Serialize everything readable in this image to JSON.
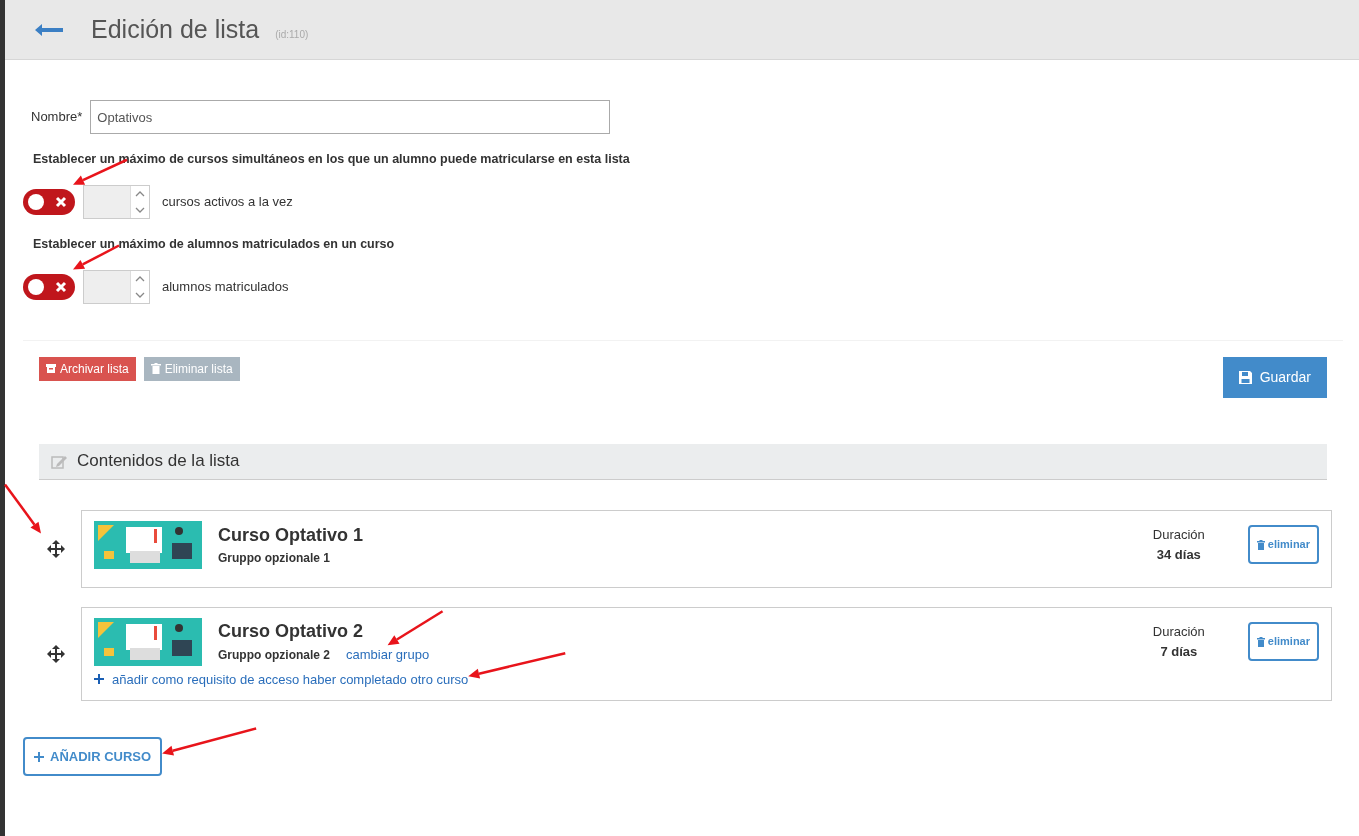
{
  "header": {
    "title": "Edición de lista",
    "id_label": "(id:110)"
  },
  "form": {
    "name_label": "Nombre*",
    "name_value": "Optativos"
  },
  "limits": [
    {
      "description": "Establecer un máximo de cursos simultáneos en los que un alumno puede matricularse en esta lista",
      "enabled": false,
      "unit_label": "cursos activos a la vez"
    },
    {
      "description": "Establecer un máximo de alumnos matriculados en un curso",
      "enabled": false,
      "unit_label": "alumnos matriculados"
    }
  ],
  "actions": [
    {
      "kind": "archive",
      "label": "Archivar lista",
      "disabled": false
    },
    {
      "kind": "delete",
      "label": "Eliminar lista",
      "disabled": true
    }
  ],
  "save_button": "Guardar",
  "contents": {
    "title": "Contenidos de la lista",
    "courses": [
      {
        "title": "Curso Optativo 1",
        "group": "Gruppo opzionale 1",
        "duration_label": "Duración",
        "duration": "34 días",
        "remove_label": "eliminar"
      },
      {
        "title": "Curso Optativo 2",
        "group": "Gruppo opzionale 2",
        "change_group_link": "cambiar grupo",
        "requirement_link": "añadir como requisito de acceso haber completado otro curso",
        "duration_label": "Duración",
        "duration": "7 días",
        "remove_label": "eliminar"
      }
    ]
  },
  "add_course_button": "AÑADIR CURSO"
}
